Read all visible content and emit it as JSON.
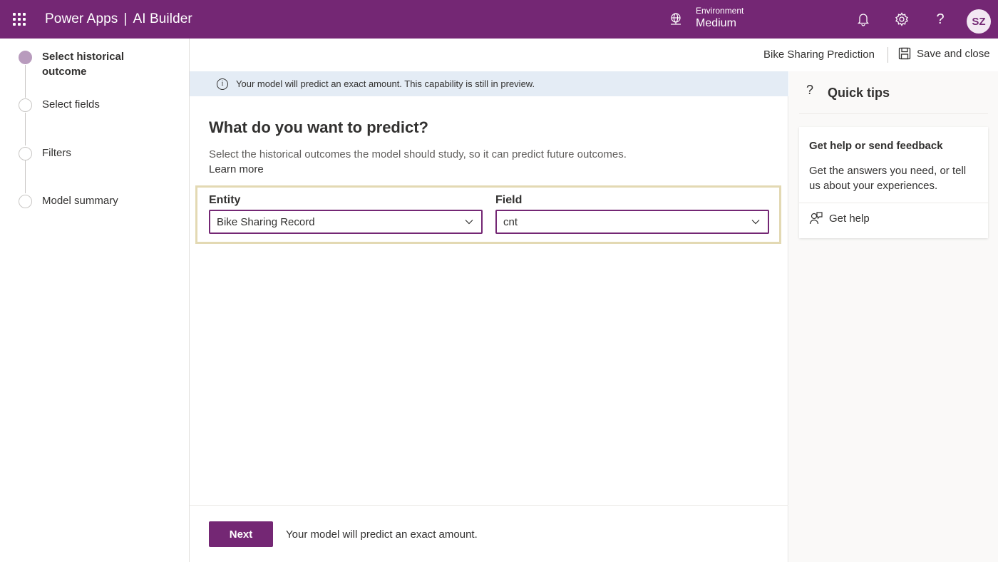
{
  "topbar": {
    "app_name": "Power Apps",
    "separator": "|",
    "product": "AI Builder",
    "environment_label": "Environment",
    "environment_value": "Medium",
    "avatar_initials": "SZ"
  },
  "stepper": {
    "steps": [
      {
        "label": "Select historical outcome",
        "active": true
      },
      {
        "label": "Select fields",
        "active": false
      },
      {
        "label": "Filters",
        "active": false
      },
      {
        "label": "Model summary",
        "active": false
      }
    ]
  },
  "commandbar": {
    "model_name": "Bike Sharing Prediction",
    "save_label": "Save and close"
  },
  "main": {
    "banner": "Your model will predict an exact amount. This capability is still in preview.",
    "heading": "What do you want to predict?",
    "description": "Select the historical outcomes the model should study, so it can predict future outcomes.",
    "learn_more": "Learn more",
    "entity_label": "Entity",
    "entity_value": "Bike Sharing Record",
    "field_label": "Field",
    "field_value": "cnt",
    "next_label": "Next",
    "footer_text": "Your model will predict an exact amount."
  },
  "tips": {
    "title": "Quick tips",
    "card_title": "Get help or send feedback",
    "card_body": "Get the answers you need, or tell us about your experiences.",
    "get_help": "Get help"
  },
  "colors": {
    "brand": "#742774",
    "banner_bg": "#e4ecf5",
    "highlight_border": "#e3d9b3"
  }
}
